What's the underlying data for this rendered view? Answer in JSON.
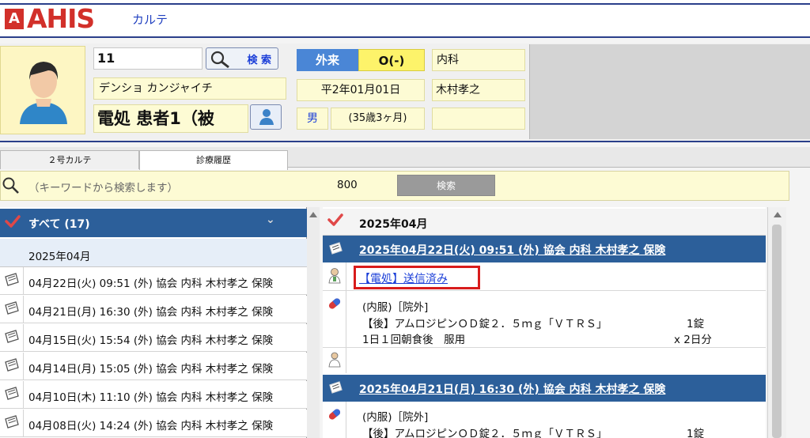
{
  "header": {
    "logo_letter": "A",
    "logo_text": "AHIS",
    "app_title": "カルテ"
  },
  "patient": {
    "id": "11",
    "search_label": "検 索",
    "kana_name": "デンショ カンジャイチ",
    "kanji_name": "電処 患者1（被",
    "visit_type": "外来",
    "blood_type": "O(-)",
    "department": "内科",
    "birth_date": "平2年01月01日",
    "doctor": "木村孝之",
    "sex": "男",
    "age": "(35歳3ヶ月)"
  },
  "tabs": [
    {
      "label": "２号カルテ"
    },
    {
      "label": "診療履歴"
    }
  ],
  "keyword_search": {
    "placeholder": "（キーワードから検索します）",
    "count": "800",
    "button_label": "検索"
  },
  "left_list": {
    "filter_label": "すべて (17)",
    "month": "2025年04月",
    "rows": [
      {
        "text": "04月22日(火) 09:51 (外) 協会 内科 木村孝之 保険"
      },
      {
        "text": "04月21日(月) 16:30 (外) 協会 内科 木村孝之 保険"
      },
      {
        "text": "04月15日(火) 15:54 (外) 協会 内科 木村孝之 保険"
      },
      {
        "text": "04月14日(月) 15:05 (外) 協会 内科 木村孝之 保険"
      },
      {
        "text": "04月10日(木) 11:10 (外) 協会 内科 木村孝之 保険"
      },
      {
        "text": "04月08日(火) 14:24 (外) 協会 内科 木村孝之 保険"
      }
    ]
  },
  "right_panel": {
    "month": "2025年04月",
    "entries": [
      {
        "header": "2025年04月22日(火) 09:51 (外) 協会 内科 木村孝之 保険",
        "status_link": "【電処】送信済み",
        "rx_type": "(内服)［院外]",
        "drug": "【後】アムロジピンＯＤ錠２．５ｍｇ「ＶＴＲＳ」",
        "drug_qty": "1錠",
        "dosage": "1日１回朝食後　服用",
        "days": "x 2日分"
      },
      {
        "header": "2025年04月21日(月) 16:30 (外) 協会 内科 木村孝之 保険",
        "rx_type": "(内服)［院外]",
        "drug": "【後】アムロジピンＯＤ錠２．５ｍｇ「ＶＴＲＳ」",
        "drug_qty": "1錠"
      }
    ]
  },
  "colors": {
    "brand_red": "#d2302a",
    "nav_blue": "#2c5f9a",
    "highlight_red": "#d81c1c",
    "visit_blue": "#4a86d6",
    "blood_yellow": "#fdf36a"
  }
}
